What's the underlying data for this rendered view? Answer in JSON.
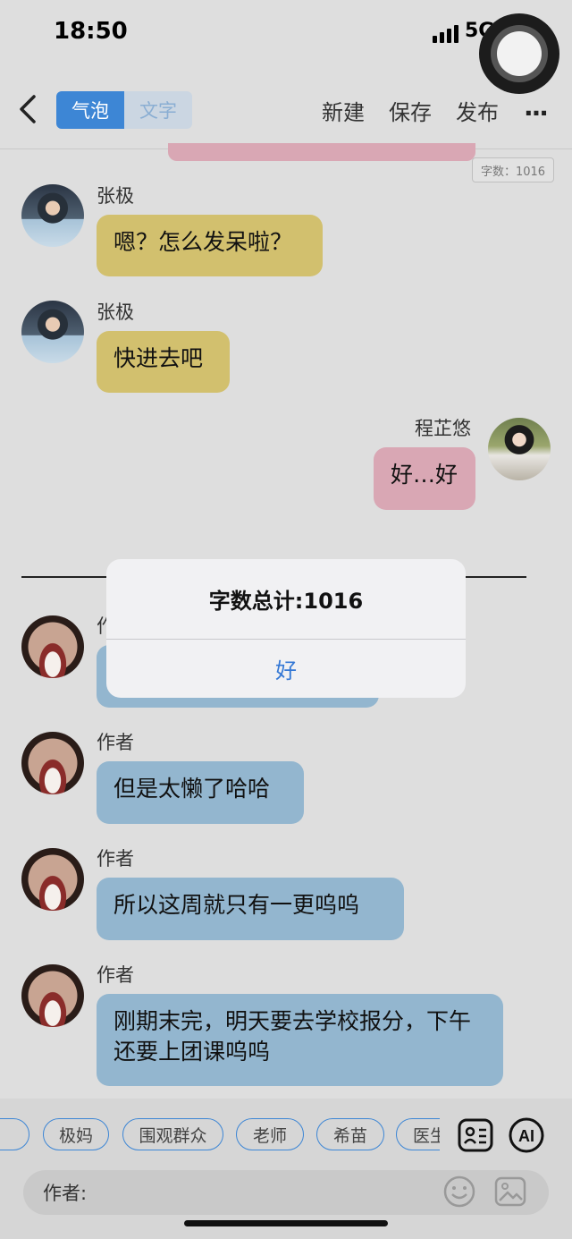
{
  "status": {
    "time": "18:50",
    "network": "5G"
  },
  "toolbar": {
    "mode_bubble": "气泡",
    "mode_text": "文字",
    "new": "新建",
    "save": "保存",
    "publish": "发布",
    "more": "···"
  },
  "word_count_badge": "字数：1016",
  "messages": [
    {
      "speaker": "张极",
      "text": "嗯？怎么发呆啦？"
    },
    {
      "speaker": "张极",
      "text": "快进去吧"
    },
    {
      "speaker": "程芷悠",
      "text": "好…好"
    },
    {
      "speaker": "作者",
      "text": ""
    },
    {
      "speaker": "作者",
      "text": "但是太懒了哈哈"
    },
    {
      "speaker": "作者",
      "text": "所以这周就只有一更呜呜"
    },
    {
      "speaker": "作者",
      "text": "刚期末完，明天要去学校报分，下午还要上团课呜呜"
    }
  ],
  "alert": {
    "title": "字数总计:1016",
    "ok": "好"
  },
  "chips": [
    "极妈",
    "围观群众",
    "老师",
    "希苗",
    "医生"
  ],
  "input": {
    "placeholder": "作者:"
  },
  "colors": {
    "accent": "#3d86d5",
    "bubble_zhangji": "#d2c06e",
    "bubble_chengzhiyou": "#d9a7b4",
    "bubble_author": "#93b6cf"
  },
  "icons": [
    "back-icon",
    "contact-card-icon",
    "ai-icon",
    "emoji-icon",
    "image-icon",
    "signal-icon"
  ]
}
